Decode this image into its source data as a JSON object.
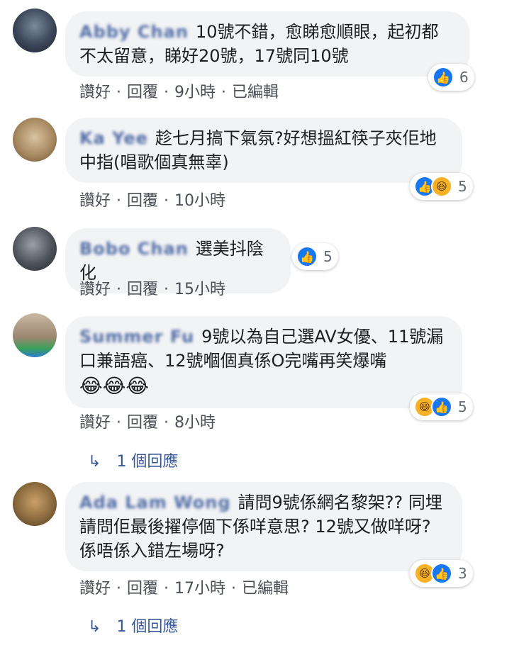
{
  "comments": [
    {
      "name": "Abby Chan",
      "text": "10號不錯，愈睇愈順眼，起初都不太留意，睇好20號，17號同10號",
      "emojis": "",
      "reactions": [
        "like"
      ],
      "count": "6",
      "like_label": "讚好",
      "reply_label": "回覆",
      "time": "9小時",
      "edited": "已編輯",
      "replies": ""
    },
    {
      "name": "Ka Yee",
      "text": "趁七月搞下氣氛?好想搵紅筷子夾佢地中指(唱歌個真無辜)",
      "emojis": "",
      "reactions": [
        "like",
        "haha"
      ],
      "count": "5",
      "like_label": "讚好",
      "reply_label": "回覆",
      "time": "10小時",
      "edited": "",
      "replies": ""
    },
    {
      "name": "Bobo Chan",
      "text": "選美抖陰化",
      "emojis": "",
      "reactions": [
        "like"
      ],
      "count": "5",
      "like_label": "讚好",
      "reply_label": "回覆",
      "time": "15小時",
      "edited": "",
      "replies": ""
    },
    {
      "name": "Summer Fu",
      "text": "9號以為自己選AV女優、11號漏口兼語癌、12號嗰個真係O完嘴再笑爆嘴",
      "emojis": "😂😂😂",
      "reactions": [
        "haha",
        "like"
      ],
      "count": "5",
      "like_label": "讚好",
      "reply_label": "回覆",
      "time": "8小時",
      "edited": "",
      "replies": "1 個回應"
    },
    {
      "name": "Ada Lam Wong",
      "text": "請問9號係網名黎架?? 同埋請問佢最後擢停個下係咩意思? 12號又做咩呀? 係唔係入錯左場呀?",
      "emojis": "",
      "reactions": [
        "haha",
        "like"
      ],
      "count": "3",
      "like_label": "讚好",
      "reply_label": "回覆",
      "time": "17小時",
      "edited": "已編輯",
      "replies": "1 個回應"
    }
  ],
  "colors": {
    "bubble": "#f2f3f5",
    "link": "#385898",
    "like": "#1877f2",
    "haha": "#f7b125"
  },
  "icons": {
    "like": "thumbs-up-icon",
    "haha": "laughing-face-icon",
    "reply_arrow": "reply-arrow-icon"
  }
}
